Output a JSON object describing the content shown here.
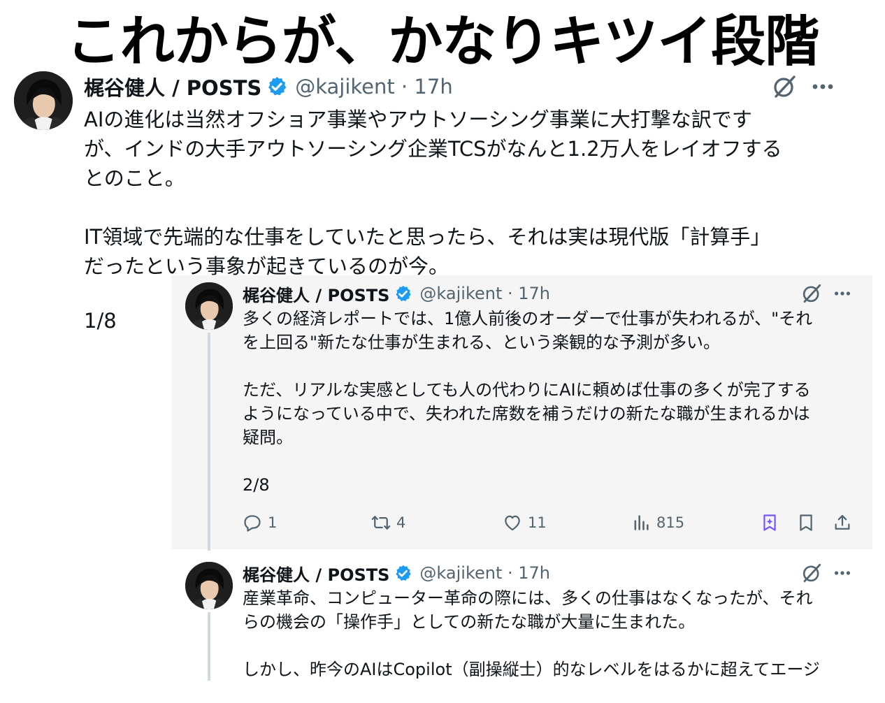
{
  "headline": "これからが、かなりキツイ段階",
  "colors": {
    "verified": "#1d9bf0",
    "muted": "#536471",
    "text": "#0f1419",
    "quote_bg": "#f5f5f5",
    "grok_accent": "#7856ff"
  },
  "main_post": {
    "author": "梶谷健人 / POSTS",
    "handle_time": "@kajikent · 17h",
    "avatar_icon": "profile-photo",
    "text": "AIの進化は当然オフショア事業やアウトソーシング事業に大打撃な訳です\nが、インドの大手アウトソーシング企業TCSがなんと1.2万人をレイオフする\nとのこと。\n\nIT領域で先端的な仕事をしていたと思ったら、それは実は現代版「計算手」\nだったという事象が起きているのが今。",
    "counter": "1/8"
  },
  "reply_1": {
    "author": "梶谷健人 / POSTS",
    "handle_time": "@kajikent · 17h",
    "text": "多くの経済レポートでは、1億人前後のオーダーで仕事が失われるが、\"それ\nを上回る\"新たな仕事が生まれる、という楽観的な予測が多い。\n\nただ、リアルな実感としても人の代わりにAIに頼めば仕事の多くが完了する\nようになっている中で、失われた席数を補うだけの新たな職が生まれるかは\n疑問。\n\n2/8",
    "actions": {
      "replies": "1",
      "reposts": "4",
      "likes": "11",
      "views": "815"
    }
  },
  "reply_2": {
    "author": "梶谷健人 / POSTS",
    "handle_time": "@kajikent · 17h",
    "text": "産業革命、コンピューター革命の際には、多くの仕事はなくなったが、それ\nらの機会の「操作手」としての新たな職が大量に生まれた。\n\nしかし、昨今のAIはCopilot（副操縦士）的なレベルをはるかに超えてエージ"
  }
}
